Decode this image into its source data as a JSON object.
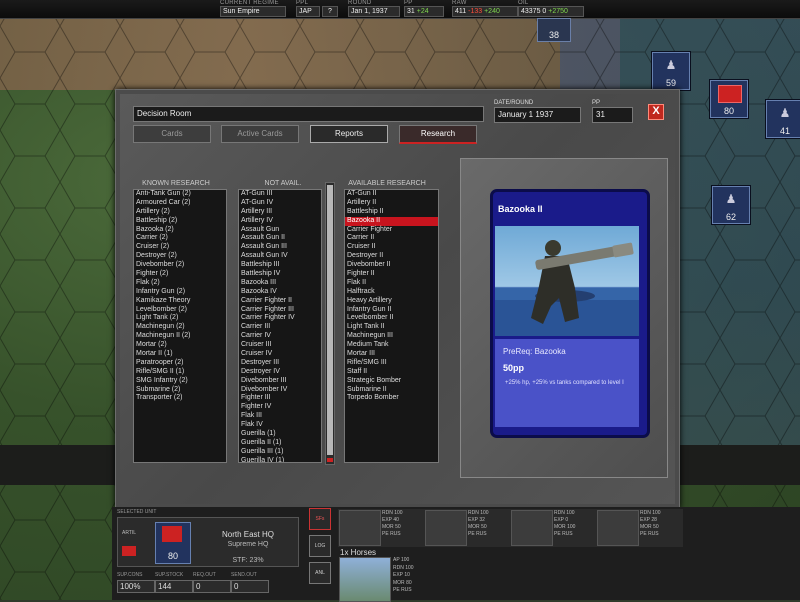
{
  "topbar": {
    "regime_label": "CURRENT REGIME",
    "regime": "Sun Empire",
    "ppl_label": "PPL",
    "ppl": "JAP",
    "help": "?",
    "round_label": "ROUND",
    "round": "Jan 1, 1937",
    "pp_label": "PP",
    "pp": "31",
    "pp_delta": "+24",
    "raw_label": "RAW",
    "raw": "411",
    "raw_minus": "-133",
    "raw_plus": "+240",
    "oil_label": "OIL",
    "oil": "43375",
    "oil_zero": "0",
    "oil_plus": "+2750"
  },
  "map_units": [
    "38",
    "59",
    "80",
    "41",
    "62"
  ],
  "dialog": {
    "title": "Decision Room",
    "date_label": "DATE/ROUND",
    "date": "January 1 1937",
    "pp_label": "PP",
    "pp": "31",
    "close": "X",
    "tabs": [
      "Cards",
      "Active Cards",
      "Reports",
      "Research"
    ],
    "known_header": "KNOWN RESEARCH",
    "not_avail_header": "NOT AVAIL.",
    "available_header": "AVAILABLE RESEARCH",
    "known": [
      "Anti-Tank Gun (2)",
      "Armoured Car (2)",
      "Artillery (2)",
      "Battleship (2)",
      "Bazooka (2)",
      "Carrier (2)",
      "Cruiser (2)",
      "Destroyer (2)",
      "Divebomber (2)",
      "Fighter (2)",
      "Flak (2)",
      "Infantry Gun (2)",
      "Kamikaze Theory",
      "Levelbomber (2)",
      "Light Tank (2)",
      "Machinegun (2)",
      "Machinegun II (2)",
      "Mortar (2)",
      "Mortar II (1)",
      "Paratrooper (2)",
      "Rifle/SMG II (1)",
      "SMG Infantry (2)",
      "Submarine (2)",
      "Transporter (2)"
    ],
    "not_avail": [
      "AT-Gun III",
      "AT-Gun IV",
      "Artillery III",
      "Artillery IV",
      "Assault Gun",
      "Assault Gun II",
      "Assault Gun III",
      "Assault Gun IV",
      "Battleship III",
      "Battleship IV",
      "Bazooka III",
      "Bazooka IV",
      "Carrier Fighter II",
      "Carrier Fighter III",
      "Carrier Fighter IV",
      "Carrier III",
      "Carrier IV",
      "Cruiser III",
      "Cruiser IV",
      "Destroyer III",
      "Destroyer IV",
      "Divebomber III",
      "Divebomber IV",
      "Fighter III",
      "Fighter IV",
      "Flak III",
      "Flak IV",
      "Guerilla (1)",
      "Guerilla II (1)",
      "Guerilla III (1)",
      "Guerilla IV (1)"
    ],
    "available": [
      "AT-Gun II",
      "Artillery II",
      "Battleship II",
      "Bazooka II",
      "Carrier Fighter",
      "Carrier II",
      "Cruiser II",
      "Destroyer II",
      "Divebomber II",
      "Fighter II",
      "Flak II",
      "Halftrack",
      "Heavy Artillery",
      "Infantry Gun II",
      "Levelbomber II",
      "Light Tank II",
      "Machinegun III",
      "Medium Tank",
      "Mortar III",
      "Rifle/SMG III",
      "Staff II",
      "Strategic Bomber",
      "Submarine II",
      "Torpedo Bomber"
    ],
    "selected_index": 3,
    "card": {
      "title": "Bazooka II",
      "prereq": "PreReq: Bazooka",
      "cost": "50pp",
      "desc": "+25% hp, +25% vs tanks compared to level I"
    }
  },
  "bottom": {
    "selected_label": "SELECTED UNIT",
    "artil": "ARTIL",
    "unit_strength": "80",
    "hq_name": "North East HQ",
    "hq_sub": "Supreme HQ",
    "stf": "STF: 23%",
    "sup_cons_label": "SUP.CONS",
    "sup_cons": "100%",
    "sup_stock_label": "SUP.STOCK",
    "sup_stock": "144",
    "req_out_label": "REQ.OUT",
    "req_out": "0",
    "send_out_label": "SEND.OUT",
    "send_out": "0",
    "side_buttons": [
      "SFs",
      "LOG",
      "ANL"
    ],
    "slots": [
      {
        "rdn": "100",
        "exp": "40",
        "mor": "50",
        "pe": "RUS"
      },
      {
        "rdn": "100",
        "exp": "32",
        "mor": "50",
        "pe": "RUS"
      },
      {
        "rdn": "100",
        "exp": "0",
        "mor": "100",
        "pe": "RUS"
      },
      {
        "rdn": "100",
        "exp": "28",
        "mor": "50",
        "pe": "RUS"
      }
    ],
    "horses_label": "1x Horses",
    "horse_stats": {
      "ap": "100",
      "rdn": "100",
      "exp": "10",
      "mor": "80",
      "pe": "RUS"
    }
  }
}
